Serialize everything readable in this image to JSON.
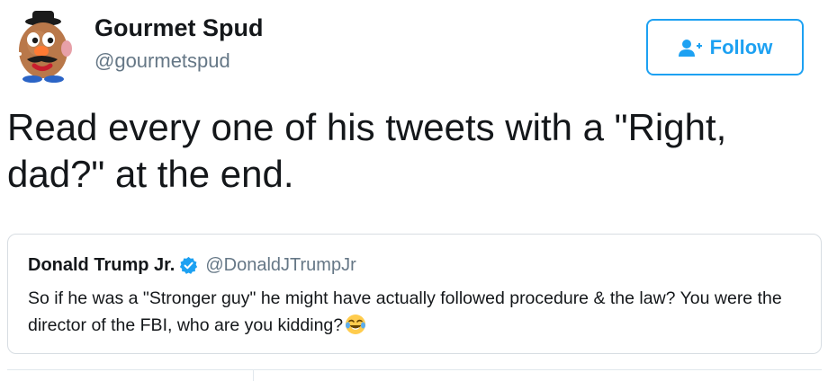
{
  "author": {
    "name": "Gourmet Spud",
    "handle": "@gourmetspud",
    "avatar_icon": "potato-character-avatar"
  },
  "follow_button": {
    "label": "Follow",
    "icon": "add-user-icon",
    "color": "#1da1f2"
  },
  "tweet": {
    "text": "Read every one of his tweets with a \"Right, dad?\" at the end."
  },
  "quoted_tweet": {
    "name": "Donald Trump Jr.",
    "verified_icon": "verified-badge-icon",
    "handle": "@DonaldJTrumpJr",
    "text": "So if he was a \"Stronger guy\" he might have actually followed procedure & the law? You were the director of the FBI, who are you kidding?",
    "emoji": "face-with-tears-of-joy-emoji"
  },
  "colors": {
    "text_primary": "#14171a",
    "text_secondary": "#657786",
    "border": "#d7dde2"
  }
}
